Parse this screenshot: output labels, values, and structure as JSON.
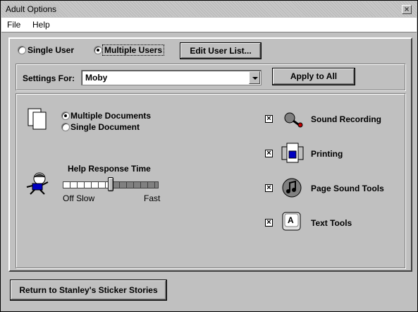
{
  "window": {
    "title": "Adult Options",
    "close_glyph": "×"
  },
  "menu": {
    "file_label": "File",
    "help_label": "Help"
  },
  "users": {
    "single_label": "Single User",
    "multiple_label": "Multiple Users",
    "selected": "multiple",
    "edit_button_label": "Edit User List..."
  },
  "settings": {
    "label": "Settings For:",
    "selected_user": "Moby",
    "apply_button_label": "Apply to All"
  },
  "documents": {
    "multiple_label": "Multiple Documents",
    "single_label": "Single Document",
    "selected": "multiple",
    "icon": "documents-icon"
  },
  "help_response": {
    "title": "Help Response Time",
    "min_label": "Off Slow",
    "max_label": "Fast",
    "value_fraction": 0.5,
    "icon": "running-character-icon"
  },
  "features": [
    {
      "label": "Sound Recording",
      "checked": true,
      "icon": "microphone-icon"
    },
    {
      "label": "Printing",
      "checked": true,
      "icon": "printer-icon"
    },
    {
      "label": "Page Sound Tools",
      "checked": true,
      "icon": "music-note-icon"
    },
    {
      "label": "Text Tools",
      "checked": true,
      "icon": "text-key-icon"
    }
  ],
  "footer": {
    "return_button_label": "Return to Stanley's Sticker Stories"
  }
}
